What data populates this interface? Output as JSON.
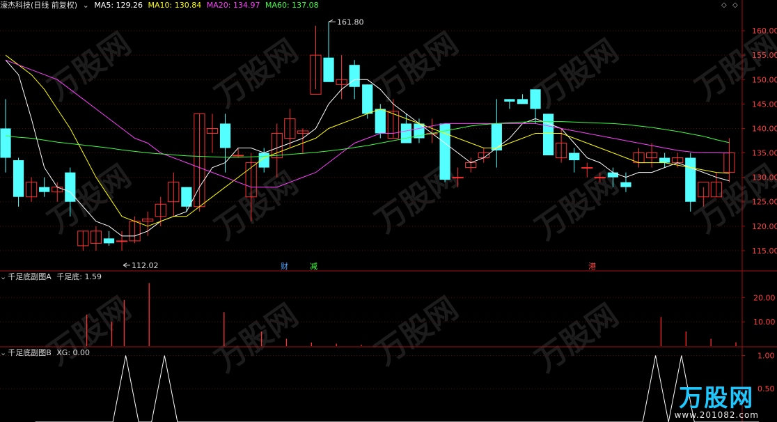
{
  "main_panel": {
    "stock_name": "濠杰科技",
    "period_label": "(日线 前复权)",
    "ma_labels": [
      {
        "label": "MA5: 129.26",
        "color": "#ffffff"
      },
      {
        "label": "MA10: 130.84",
        "color": "#ffff00"
      },
      {
        "label": "MA20: 134.97",
        "color": "#ff40ff"
      },
      {
        "label": "MA60: 137.08",
        "color": "#40ff40"
      }
    ],
    "high_marker": "161.80",
    "low_marker": "112.02",
    "event_tags": [
      {
        "label": "财",
        "color": "#4aa3ff"
      },
      {
        "label": "减",
        "color": "#40ff40"
      },
      {
        "label": "港",
        "color": "#ff4040"
      }
    ]
  },
  "sub_panel_a": {
    "title": "千足底副图A",
    "indicator": "千足底: 1.59"
  },
  "sub_panel_b": {
    "title": "千足底副图B",
    "indicator": "XG: 0.00"
  },
  "watermark": {
    "text": "万股网",
    "url": "www.201082.com"
  },
  "chart_data": [
    {
      "type": "candlestick",
      "name": "price",
      "y_axis": [
        115.0,
        120.0,
        125.0,
        130.0,
        135.0,
        140.0,
        145.0,
        150.0,
        155.0,
        160.0
      ],
      "ylim": [
        111,
        164
      ],
      "candles": [
        [
          140,
          146,
          131,
          134
        ],
        [
          133.5,
          134,
          124,
          126
        ],
        [
          126,
          130,
          125,
          129
        ],
        [
          128,
          130,
          126,
          127
        ],
        [
          127,
          129,
          125,
          128
        ],
        [
          131,
          132,
          122,
          125
        ],
        [
          116,
          119,
          115,
          119
        ],
        [
          116.5,
          120,
          115,
          119
        ],
        [
          117.5,
          119,
          116,
          116.5
        ],
        [
          117,
          119,
          115,
          117
        ],
        [
          117,
          122,
          116.5,
          121
        ],
        [
          121,
          123,
          118,
          121.5
        ],
        [
          122,
          126,
          120,
          124.5
        ],
        [
          125,
          131,
          122,
          129
        ],
        [
          128,
          128,
          123,
          124
        ],
        [
          124,
          143,
          123,
          143
        ],
        [
          139,
          143,
          135,
          140
        ],
        [
          141,
          143,
          131,
          136
        ],
        [
          134.5,
          136,
          134,
          134.5
        ],
        [
          126,
          135,
          121,
          133
        ],
        [
          135,
          136,
          131,
          132
        ],
        [
          134,
          141,
          130,
          139
        ],
        [
          138,
          144,
          136,
          142
        ],
        [
          139,
          140,
          135,
          139.5
        ],
        [
          147,
          161,
          148,
          155
        ],
        [
          154.5,
          161.8,
          150,
          149.5
        ],
        [
          149,
          155,
          146,
          150
        ],
        [
          153,
          154,
          146,
          148.5
        ],
        [
          149,
          149,
          142,
          143
        ],
        [
          144,
          145,
          138,
          139
        ],
        [
          138,
          146,
          138,
          143.5
        ],
        [
          141,
          143,
          137,
          137
        ],
        [
          141,
          142,
          137,
          138
        ],
        [
          139,
          142,
          137,
          139
        ],
        [
          141,
          141,
          129,
          129.5
        ],
        [
          130,
          132,
          128,
          130
        ],
        [
          132,
          134,
          131,
          133
        ],
        [
          134,
          136,
          133,
          135
        ],
        [
          141,
          146,
          132,
          135.5
        ],
        [
          146,
          146,
          144,
          145.5
        ],
        [
          146,
          147,
          145,
          145
        ],
        [
          148,
          148,
          141,
          144
        ],
        [
          143,
          143,
          135,
          134.5
        ],
        [
          134,
          140,
          133,
          137
        ],
        [
          135,
          136,
          131,
          133.5
        ],
        [
          132,
          133,
          130,
          132
        ],
        [
          130,
          131,
          129,
          130
        ],
        [
          131,
          132,
          128,
          130
        ],
        [
          129,
          131,
          127,
          128
        ],
        [
          133,
          136,
          132,
          135
        ],
        [
          134,
          137,
          132,
          135
        ],
        [
          134,
          135,
          132,
          133
        ],
        [
          133,
          135,
          132,
          134
        ],
        [
          134,
          135,
          123,
          125
        ],
        [
          126,
          128,
          124,
          129
        ],
        [
          126,
          131,
          126,
          129
        ],
        [
          131,
          138,
          129,
          135
        ]
      ],
      "ma5": [
        154,
        151,
        142,
        132,
        128,
        127,
        124,
        121,
        120,
        118,
        118,
        119,
        121,
        122,
        123,
        128,
        132,
        133,
        136,
        136,
        135,
        136,
        137,
        138,
        140,
        145,
        148,
        150,
        150,
        148,
        145,
        143,
        141,
        139,
        137,
        135,
        133,
        134,
        136,
        138,
        141,
        142,
        141,
        140,
        137,
        134,
        133,
        131,
        130,
        131,
        131,
        132,
        133,
        132,
        131,
        130,
        129.3
      ],
      "ma10": [
        155,
        153,
        151,
        148,
        144,
        140,
        135,
        130,
        126,
        122,
        121,
        120,
        121,
        122,
        122,
        124,
        126,
        128,
        130,
        132,
        134,
        135,
        136,
        137,
        138,
        140,
        141,
        142,
        143,
        144,
        143,
        142,
        141,
        140,
        139,
        138,
        137,
        136,
        136,
        137,
        138,
        139,
        139,
        139,
        138,
        137,
        136,
        135,
        134,
        133,
        133,
        133,
        132.5,
        132,
        131.5,
        131,
        130.84
      ],
      "ma20": [
        154,
        153,
        152,
        151,
        150,
        148,
        146,
        144,
        142,
        140,
        138,
        137,
        135,
        134,
        133,
        132,
        131,
        130,
        129,
        128,
        128,
        128,
        129,
        130,
        131,
        133,
        135,
        137,
        138,
        139,
        139,
        139.5,
        140,
        140.5,
        141,
        141,
        141,
        141,
        141,
        141,
        141,
        141,
        140.5,
        140,
        139.5,
        139,
        138.5,
        138,
        137.5,
        137,
        136.5,
        136,
        135.5,
        135.2,
        135,
        135,
        134.97
      ],
      "ma60": [
        138.5,
        138.2,
        138,
        137.6,
        137.2,
        136.9,
        136.6,
        136.3,
        136,
        135.6,
        135.3,
        135,
        134.8,
        134.6,
        134.4,
        134.3,
        134.2,
        134.1,
        134.1,
        134.2,
        134.3,
        134.5,
        134.7,
        134.9,
        135.1,
        135.4,
        135.7,
        136.1,
        136.5,
        137,
        137.5,
        138,
        138.5,
        139,
        139.5,
        140,
        140.5,
        140.8,
        141,
        141.2,
        141.3,
        141.4,
        141.4,
        141.4,
        141.3,
        141.2,
        141.1,
        141,
        140.8,
        140.5,
        140.2,
        139.8,
        139.4,
        138.9,
        138.4,
        137.7,
        137.08
      ]
    },
    {
      "type": "bar",
      "name": "千足底",
      "y_axis": [
        10.0,
        20.0
      ],
      "ylim": [
        0,
        29
      ],
      "values": [
        0,
        0,
        0,
        0,
        0,
        0,
        13,
        0,
        10,
        19,
        0,
        26,
        0,
        0,
        0,
        0,
        0,
        14,
        0,
        0,
        6,
        0,
        3,
        0,
        1.5,
        0,
        1,
        0,
        0.5,
        0,
        0,
        0,
        0,
        0,
        0,
        0,
        0,
        0,
        0,
        0,
        0,
        0,
        0,
        0,
        0,
        0,
        0,
        0,
        0,
        0,
        0,
        0,
        12,
        0,
        6,
        0,
        3,
        0,
        1.59
      ]
    },
    {
      "type": "line",
      "name": "XG",
      "y_axis": [
        0.5,
        1.0
      ],
      "ylim": [
        0,
        1.12
      ],
      "values": [
        0,
        0,
        0,
        0,
        0,
        0,
        0,
        1,
        0,
        0,
        1,
        0,
        0,
        0,
        0,
        0,
        0,
        0,
        0,
        0,
        0,
        0,
        0,
        0,
        0,
        0,
        0,
        0,
        0,
        0,
        0,
        0,
        0,
        0,
        0,
        0,
        0,
        0,
        0,
        0,
        0,
        0,
        0,
        0,
        0,
        0,
        0,
        0,
        1,
        0,
        1,
        0,
        0,
        0,
        0,
        0,
        0
      ]
    }
  ]
}
